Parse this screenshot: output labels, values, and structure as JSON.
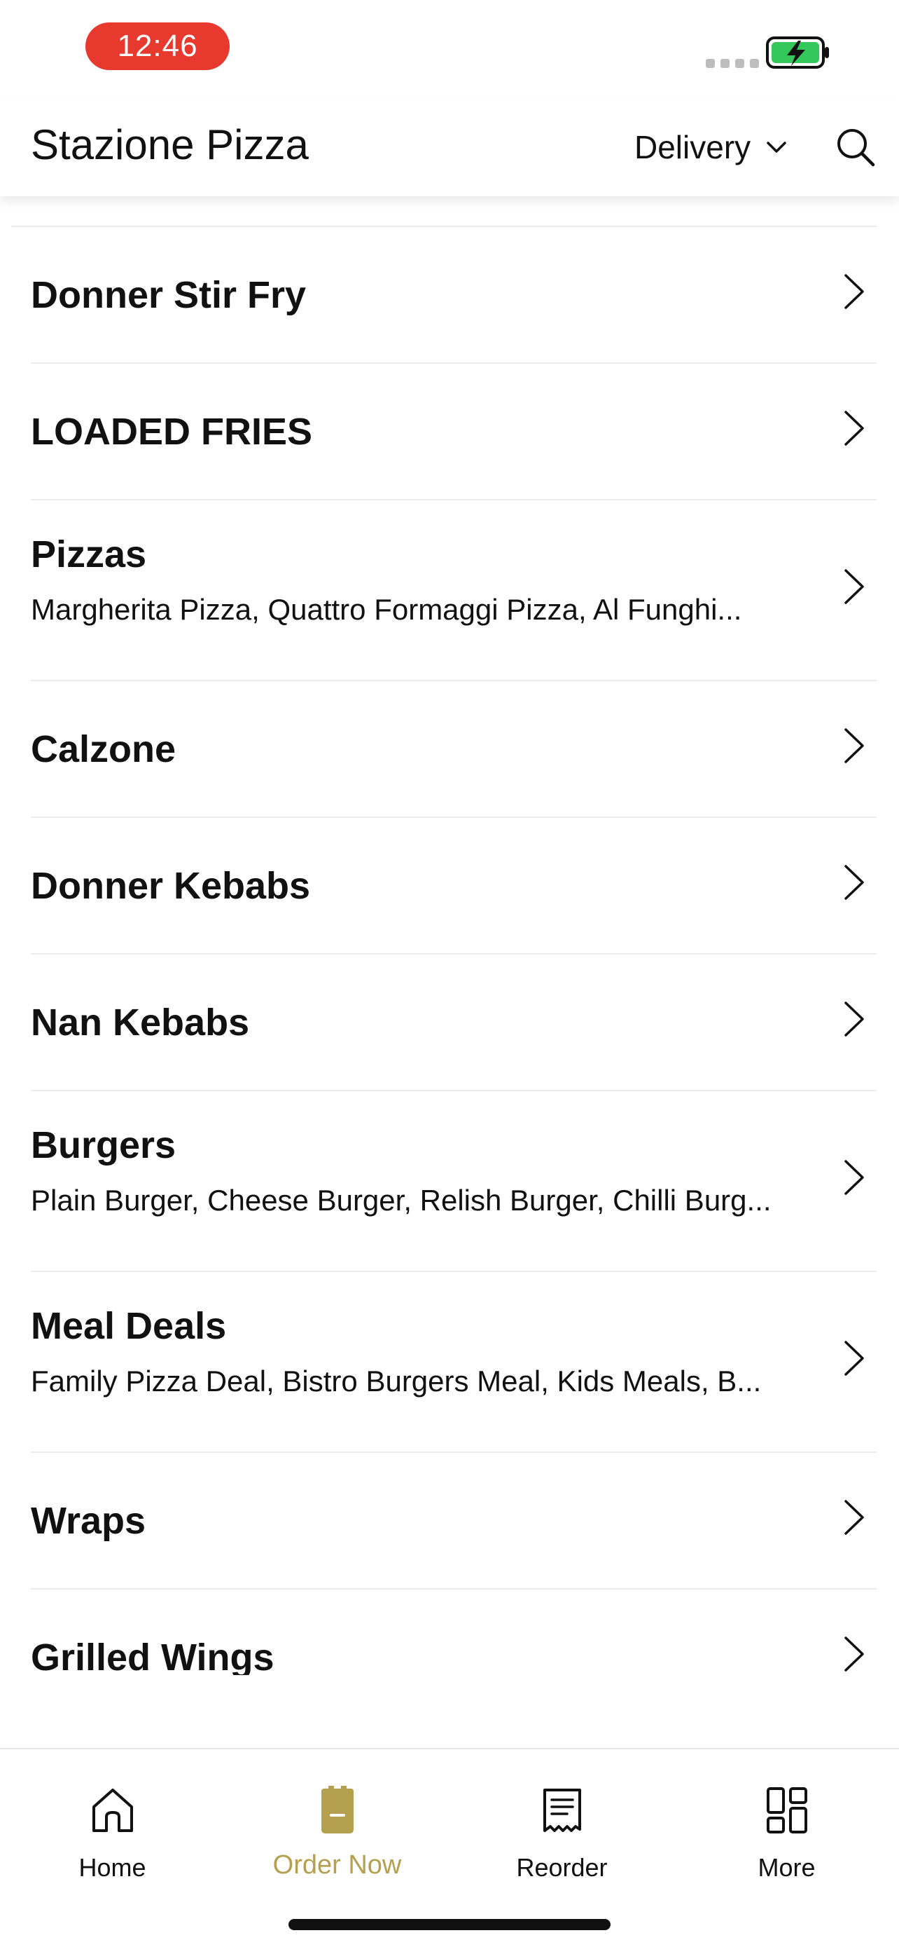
{
  "status_bar": {
    "time": "12:46"
  },
  "header": {
    "title": "Stazione Pizza",
    "mode_label": "Delivery",
    "icons": {
      "mode": "chevron-down-icon",
      "search": "search-icon"
    }
  },
  "menu": {
    "items": [
      {
        "title": "Donner Stir Fry",
        "subtitle": ""
      },
      {
        "title": "LOADED FRIES",
        "subtitle": ""
      },
      {
        "title": "Pizzas",
        "subtitle": "Margherita Pizza, Quattro Formaggi Pizza, Al Funghi..."
      },
      {
        "title": "Calzone",
        "subtitle": ""
      },
      {
        "title": "Donner Kebabs",
        "subtitle": ""
      },
      {
        "title": "Nan Kebabs",
        "subtitle": ""
      },
      {
        "title": "Burgers",
        "subtitle": "Plain Burger, Cheese Burger, Relish Burger, Chilli Burg..."
      },
      {
        "title": "Meal Deals",
        "subtitle": "Family  Pizza Deal, Bistro Burgers Meal, Kids Meals, B..."
      },
      {
        "title": "Wraps",
        "subtitle": ""
      },
      {
        "title": "Grilled Wings",
        "subtitle": ""
      }
    ]
  },
  "tab_bar": {
    "active_color": "#b5a04f",
    "tabs": [
      {
        "label": "Home",
        "icon": "home-icon",
        "active": false
      },
      {
        "label": "Order Now",
        "icon": "order-icon",
        "active": true
      },
      {
        "label": "Reorder",
        "icon": "receipt-icon",
        "active": false
      },
      {
        "label": "More",
        "icon": "grid-icon",
        "active": false
      }
    ]
  },
  "colors": {
    "time_pill": "#e8392f",
    "battery": "#34c759",
    "accent": "#b5a04f"
  }
}
